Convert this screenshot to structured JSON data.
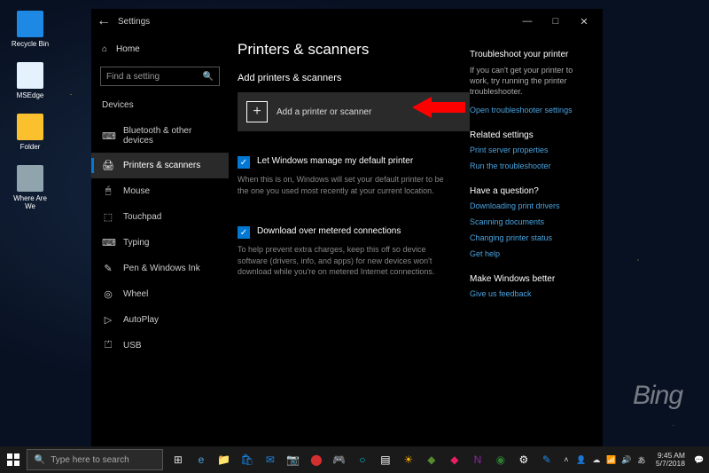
{
  "desktop": {
    "bing_label": "Bing",
    "icons": [
      {
        "label": "Recycle Bin"
      },
      {
        "label": "MSEdge"
      },
      {
        "label": "Folder"
      },
      {
        "label": "Where Are We"
      }
    ]
  },
  "window": {
    "app_name": "Settings",
    "controls": {
      "min": "—",
      "max": "□",
      "close": "✕"
    }
  },
  "sidebar": {
    "home_label": "Home",
    "search_placeholder": "Find a setting",
    "section": "Devices",
    "items": [
      {
        "icon": "⌨",
        "label": "Bluetooth & other devices"
      },
      {
        "icon": "🖨",
        "label": "Printers & scanners"
      },
      {
        "icon": "🖱",
        "label": "Mouse"
      },
      {
        "icon": "⬚",
        "label": "Touchpad"
      },
      {
        "icon": "⌨",
        "label": "Typing"
      },
      {
        "icon": "✎",
        "label": "Pen & Windows Ink"
      },
      {
        "icon": "◎",
        "label": "Wheel"
      },
      {
        "icon": "▷",
        "label": "AutoPlay"
      },
      {
        "icon": "⏍",
        "label": "USB"
      }
    ]
  },
  "main": {
    "title": "Printers & scanners",
    "add_heading": "Add printers & scanners",
    "add_button": "Add a printer or scanner",
    "manage_check": "Let Windows manage my default printer",
    "manage_desc": "When this is on, Windows will set your default printer to be the one you used most recently at your current location.",
    "metered_check": "Download over metered connections",
    "metered_desc": "To help prevent extra charges, keep this off so device software (drivers, info, and apps) for new devices won't download while you're on metered Internet connections."
  },
  "right": {
    "troubleshoot_head": "Troubleshoot your printer",
    "troubleshoot_desc": "If you can't get your printer to work, try running the printer troubleshooter.",
    "troubleshoot_link": "Open troubleshooter settings",
    "related_head": "Related settings",
    "related_links": [
      "Print server properties",
      "Run the troubleshooter"
    ],
    "question_head": "Have a question?",
    "question_links": [
      "Downloading print drivers",
      "Scanning documents",
      "Changing printer status",
      "Get help"
    ],
    "better_head": "Make Windows better",
    "better_link": "Give us feedback"
  },
  "taskbar": {
    "search_placeholder": "Type here to search",
    "time": "9:45 AM",
    "date": "5/7/2018"
  }
}
